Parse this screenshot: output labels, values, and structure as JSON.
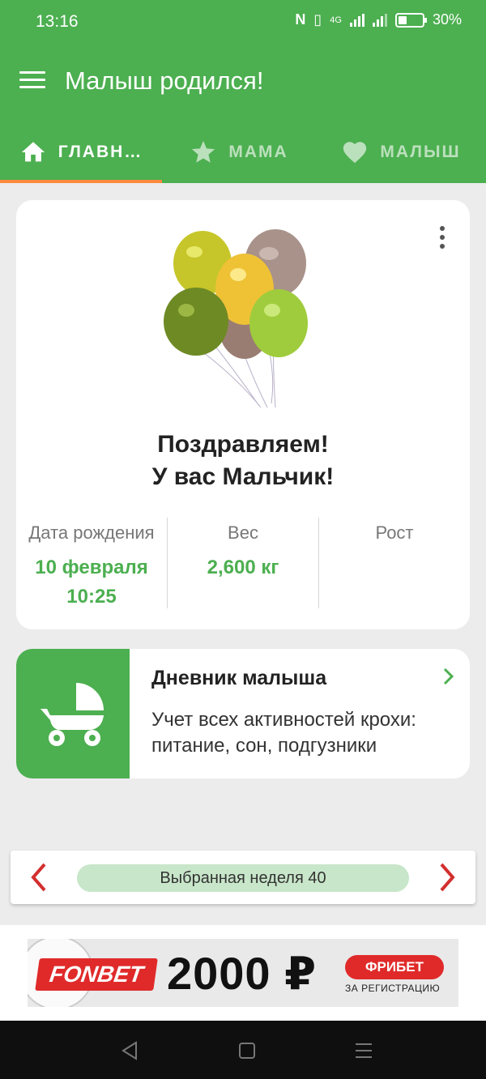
{
  "status_bar": {
    "time": "13:16",
    "network": "4G",
    "battery_percent": "30%"
  },
  "app_bar": {
    "title": "Малыш родился!"
  },
  "tabs": [
    {
      "label": "ГЛАВН…",
      "icon": "home-icon",
      "active": true
    },
    {
      "label": "МАМА",
      "icon": "star-icon",
      "active": false
    },
    {
      "label": "МАЛЫШ",
      "icon": "heart-icon",
      "active": false
    }
  ],
  "birth_card": {
    "congrats_line1": "Поздравляем!",
    "congrats_line2": "У вас Мальчик!",
    "stats": [
      {
        "label": "Дата рождения",
        "value_line1": "10 февраля",
        "value_line2": "10:25"
      },
      {
        "label": "Вес",
        "value_line1": "2,600 кг",
        "value_line2": ""
      },
      {
        "label": "Рост",
        "value_line1": "",
        "value_line2": ""
      }
    ]
  },
  "diary_card": {
    "title": "Дневник малыша",
    "description": "Учет всех активностей крохи: питание, сон, подгузники"
  },
  "week_selector": {
    "label": "Выбранная неделя 40"
  },
  "ad": {
    "brand": "FONBET",
    "amount": "2000 ₽",
    "badge": "ФРИБЕТ",
    "subtitle": "ЗА РЕГИСТРАЦИЮ"
  },
  "colors": {
    "primary": "#4caf50",
    "tab_indicator": "#ff8a3d",
    "arrow": "#d32f2f",
    "week_pill": "#c8e6c9",
    "ad_red": "#e02a2a"
  }
}
